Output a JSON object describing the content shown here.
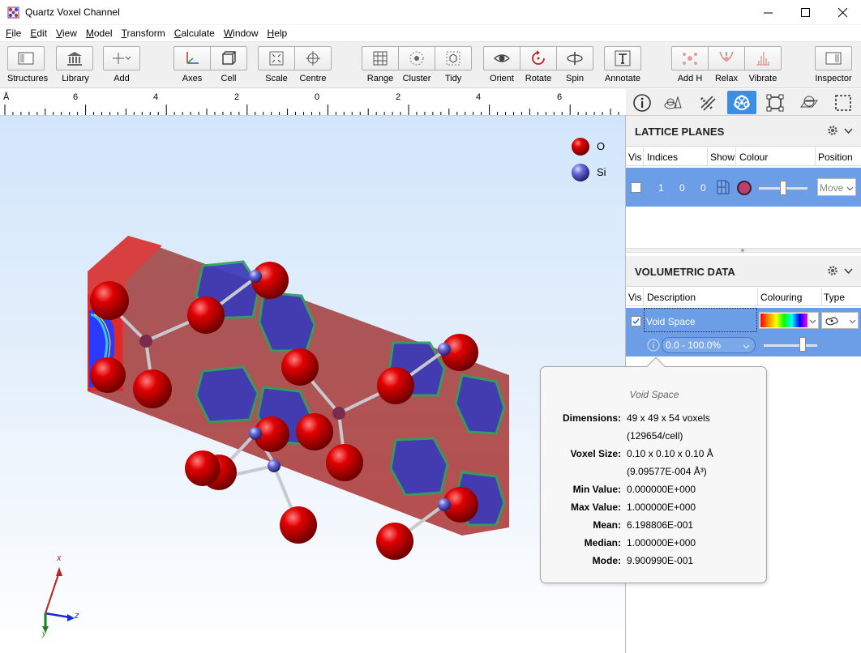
{
  "window": {
    "title": "Quartz Voxel Channel"
  },
  "menu": [
    {
      "label": "File",
      "u": "F",
      "rest": "ile"
    },
    {
      "label": "Edit",
      "u": "E",
      "rest": "dit"
    },
    {
      "label": "View",
      "u": "V",
      "rest": "iew"
    },
    {
      "label": "Model",
      "u": "M",
      "rest": "odel"
    },
    {
      "label": "Transform",
      "u": "T",
      "rest": "ransform"
    },
    {
      "label": "Calculate",
      "u": "C",
      "rest": "alculate"
    },
    {
      "label": "Window",
      "u": "W",
      "rest": "indow"
    },
    {
      "label": "Help",
      "u": "H",
      "rest": "elp"
    }
  ],
  "toolbar": {
    "structures": "Structures",
    "library": "Library",
    "add": "Add",
    "axes": "Axes",
    "cell": "Cell",
    "scale": "Scale",
    "centre": "Centre",
    "range": "Range",
    "cluster": "Cluster",
    "tidy": "Tidy",
    "orient": "Orient",
    "rotate": "Rotate",
    "spin": "Spin",
    "annotate": "Annotate",
    "add_h": "Add H",
    "relax": "Relax",
    "vibrate": "Vibrate",
    "inspector": "Inspector"
  },
  "ruler": {
    "unit": "Å",
    "ticks": [
      "6",
      "4",
      "2",
      "0",
      "2",
      "4",
      "6"
    ]
  },
  "legend": [
    {
      "label": "O",
      "color": "#d40000"
    },
    {
      "label": "Si",
      "color": "#6060d0"
    }
  ],
  "axes_triad": {
    "x": "x",
    "y": "y",
    "z": "z"
  },
  "lattice_planes": {
    "title": "LATTICE PLANES",
    "columns": {
      "vis": "Vis",
      "indices": "Indices",
      "show": "Show",
      "colour": "Colour",
      "position": "Position"
    },
    "row": {
      "h": "1",
      "k": "0",
      "l": "0",
      "color": "#b8406a",
      "position": "Move",
      "slider_fraction": 0.5
    }
  },
  "volumetric": {
    "title": "VOLUMETRIC DATA",
    "columns": {
      "vis": "Vis",
      "description": "Description",
      "colouring": "Colouring",
      "type": "Type"
    },
    "row": {
      "description": "Void Space",
      "range": "0.0 - 100.0%",
      "slider_fraction": 0.75
    }
  },
  "tooltip": {
    "title": "Void Space",
    "rows": [
      {
        "key": "Dimensions:",
        "value": "49 x 49 x 54 voxels"
      },
      {
        "key": "",
        "value": "(129654/cell)"
      },
      {
        "key": "Voxel Size:",
        "value": "0.10 x 0.10 x 0.10 Å"
      },
      {
        "key": "",
        "value": "(9.09577E-004 Å³)"
      },
      {
        "key": "Min Value:",
        "value": "0.000000E+000"
      },
      {
        "key": "Max Value:",
        "value": "1.000000E+000"
      },
      {
        "key": "Mean:",
        "value": "6.198806E-001"
      },
      {
        "key": "Median:",
        "value": "1.000000E+000"
      },
      {
        "key": "Mode:",
        "value": "9.900990E-001"
      }
    ]
  }
}
